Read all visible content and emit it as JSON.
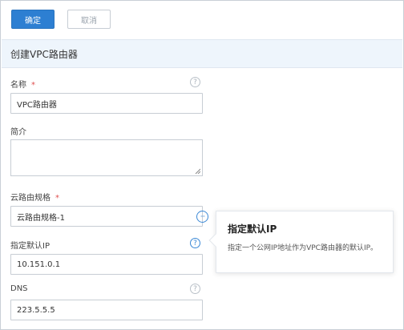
{
  "toolbar": {
    "confirm_label": "确定",
    "cancel_label": "取消"
  },
  "section": {
    "title": "创建VPC路由器"
  },
  "form": {
    "name": {
      "label": "名称",
      "required_mark": "*",
      "value": "VPC路由器"
    },
    "description": {
      "label": "简介",
      "value": ""
    },
    "spec": {
      "label": "云路由规格",
      "required_mark": "*",
      "value": "云路由规格-1",
      "more_icon": "···"
    },
    "default_ip": {
      "label": "指定默认IP",
      "value": "10.151.0.1"
    },
    "dns": {
      "label": "DNS",
      "value": "223.5.5.5"
    },
    "help_icon": "?"
  },
  "tooltip": {
    "title": "指定默认IP",
    "body": "指定一个公网IP地址作为VPC路由器的默认IP。"
  },
  "colors": {
    "primary": "#2d7fd2",
    "section_bg": "#eef5fc",
    "required": "#e05050"
  }
}
